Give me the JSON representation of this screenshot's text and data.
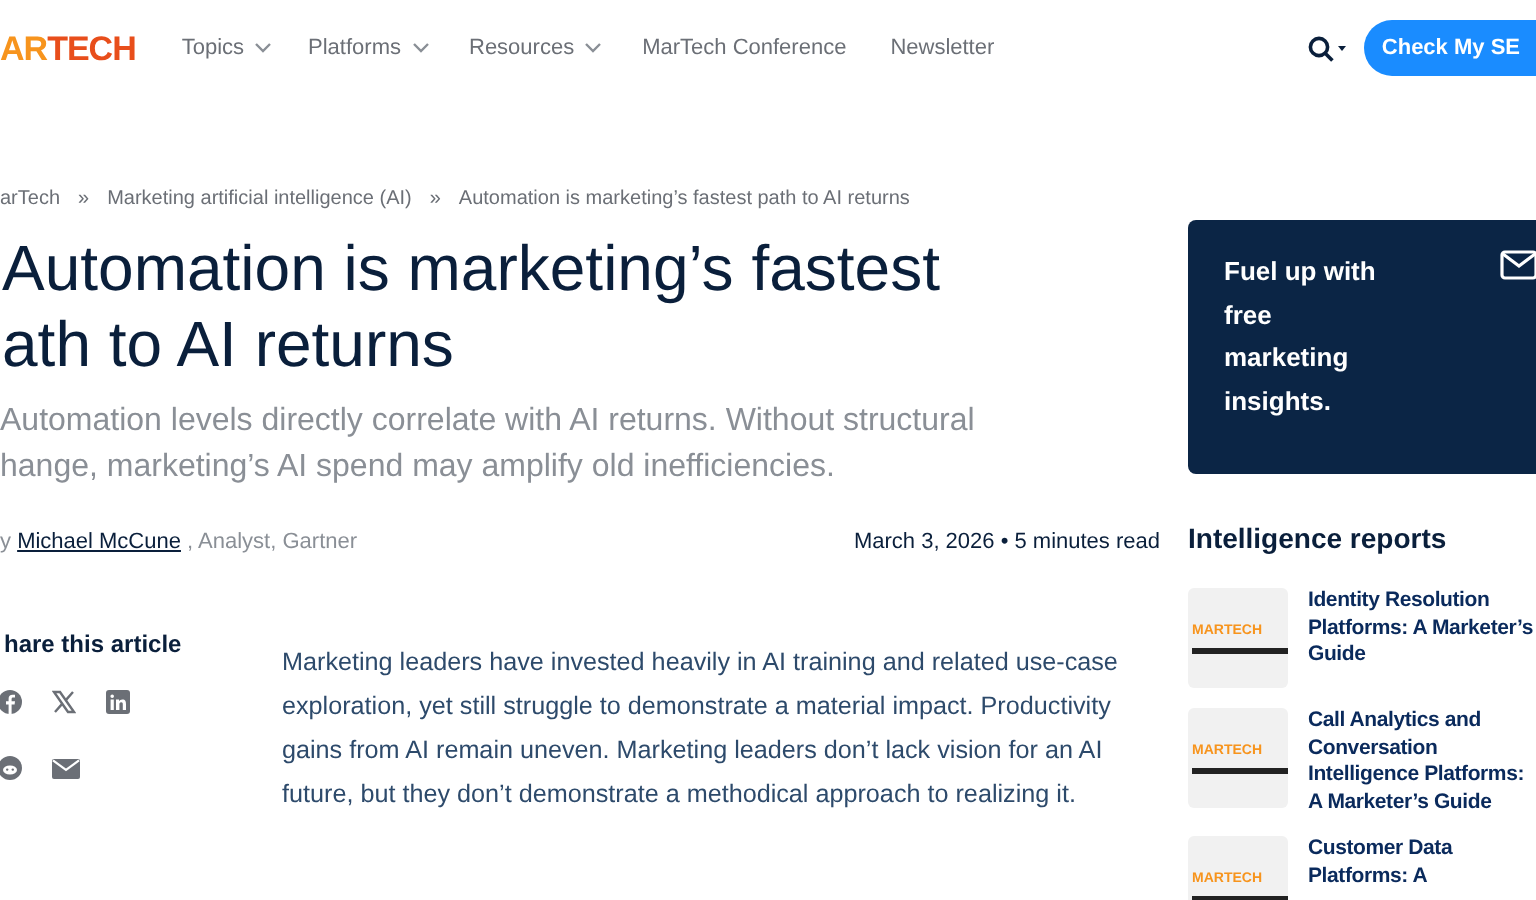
{
  "header": {
    "logo": [
      "AR",
      "TECH"
    ],
    "nav": [
      {
        "label": "Topics",
        "dropdown": true
      },
      {
        "label": "Platforms",
        "dropdown": true
      },
      {
        "label": "Resources",
        "dropdown": true
      },
      {
        "label": "MarTech Conference",
        "dropdown": false
      },
      {
        "label": "Newsletter",
        "dropdown": false
      }
    ],
    "cta": "Check My SE"
  },
  "breadcrumb": [
    "arTech",
    "Marketing artificial intelligence (AI)",
    "Automation is marketing’s fastest path to AI returns"
  ],
  "breadcrumb_separator": "»",
  "article": {
    "title_lines": [
      "Automation is marketing’s fastest",
      "ath to AI returns"
    ],
    "subtitle_lines": [
      "Automation levels directly correlate with AI returns. Without structural",
      "hange, marketing’s AI spend may amplify old inefficiencies."
    ],
    "byline": {
      "prefix": "y",
      "author": "Michael McCune",
      "suffix": ", Analyst, Gartner"
    },
    "meta": "March 3, 2026 • 5 minutes read",
    "share_heading": "hare this article",
    "share_icons": [
      {
        "kind": "facebook"
      },
      {
        "kind": "x"
      },
      {
        "kind": "linkedin"
      },
      {
        "kind": "reddit"
      },
      {
        "kind": "email"
      }
    ],
    "body": "Marketing leaders have invested heavily in AI training and related use-case exploration, yet still struggle to demonstrate a material impact. Productivity gains from AI remain uneven. Marketing leaders don’t lack vision for an AI future, but they don’t demonstrate a methodical approach to realizing it."
  },
  "sidebar": {
    "promo_lines": [
      "Fuel up with",
      "free",
      "marketing",
      "insights."
    ],
    "reports_heading": "Intelligence reports",
    "reports": [
      {
        "title": "Identity Resolution Platforms: A Marketer’s Guide",
        "cover_logo": "MARTECH"
      },
      {
        "title": "Call Analytics and Conversation Intelligence Platforms: A Marketer’s Guide",
        "cover_logo": "MARTECH"
      },
      {
        "title": "Customer Data Platforms: A",
        "cover_logo": "MARTECH"
      }
    ]
  }
}
